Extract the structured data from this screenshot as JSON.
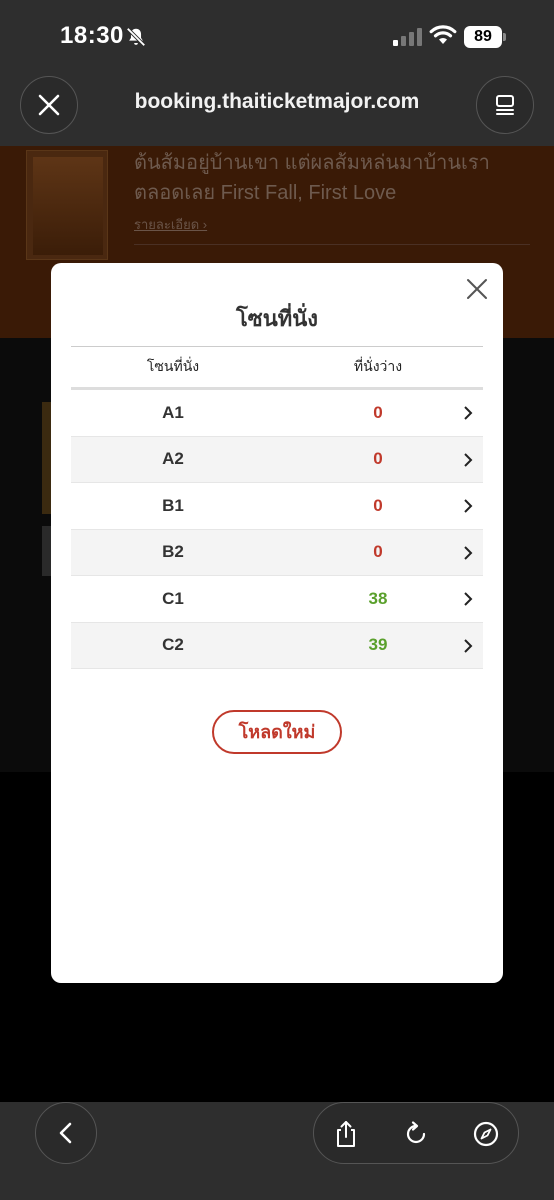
{
  "status": {
    "time": "18:30",
    "battery": "89"
  },
  "browser": {
    "url": "booking.thaiticketmajor.com"
  },
  "background": {
    "event_title": "ต้นส้มอยู่บ้านเขา แต่ผลส้มหล่นมาบ้านเราตลอดเลย First Fall, First Love",
    "detail_link": "รายละเอียด ›"
  },
  "modal": {
    "title": "โซนที่นั่ง",
    "columns": {
      "zone": "โซนที่นั่ง",
      "available": "ที่นั่งว่าง"
    },
    "rows": [
      {
        "zone": "A1",
        "available": "0",
        "color": "#c0392b"
      },
      {
        "zone": "A2",
        "available": "0",
        "color": "#c0392b"
      },
      {
        "zone": "B1",
        "available": "0",
        "color": "#c0392b"
      },
      {
        "zone": "B2",
        "available": "0",
        "color": "#c0392b"
      },
      {
        "zone": "C1",
        "available": "38",
        "color": "#5aa02c"
      },
      {
        "zone": "C2",
        "available": "39",
        "color": "#5aa02c"
      }
    ],
    "reload_label": "โหลดใหม่"
  },
  "colors": {
    "accent_red": "#c0392b",
    "available_green": "#5aa02c"
  }
}
